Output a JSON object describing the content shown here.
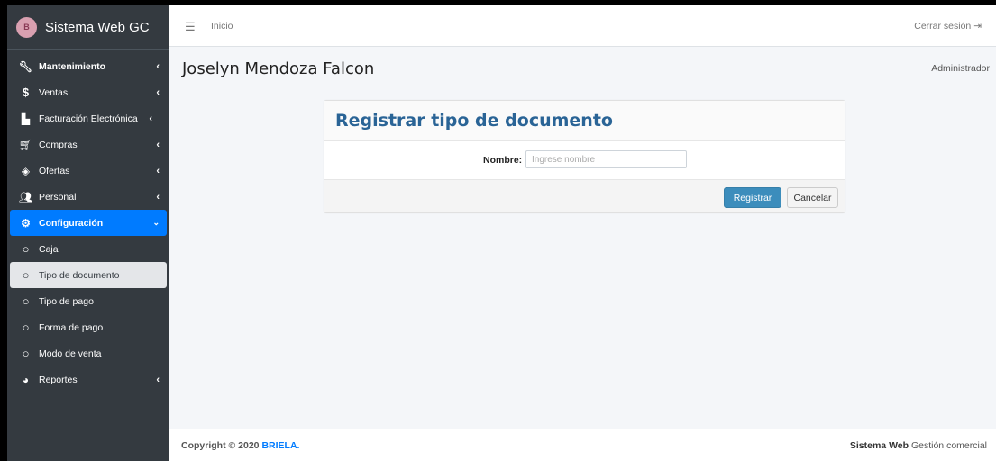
{
  "brand": {
    "name": "Sistema Web GC",
    "logo_text": "B"
  },
  "sidebar": {
    "items": [
      {
        "label": "Mantenimiento",
        "icon": "wrench-icon"
      },
      {
        "label": "Ventas",
        "icon": "dollar-icon"
      },
      {
        "label": "Facturación Electrónica",
        "icon": "building-icon"
      },
      {
        "label": "Compras",
        "icon": "cart-icon"
      },
      {
        "label": "Ofertas",
        "icon": "tags-icon"
      },
      {
        "label": "Personal",
        "icon": "users-icon"
      },
      {
        "label": "Configuración",
        "icon": "gear-icon"
      },
      {
        "label": "Caja",
        "icon": "circle-icon"
      },
      {
        "label": "Tipo de documento",
        "icon": "circle-icon"
      },
      {
        "label": "Tipo de pago",
        "icon": "circle-icon"
      },
      {
        "label": "Forma de pago",
        "icon": "circle-icon"
      },
      {
        "label": "Modo de venta",
        "icon": "circle-icon"
      },
      {
        "label": "Reportes",
        "icon": "pie-chart-icon"
      }
    ]
  },
  "topbar": {
    "home": "Inicio",
    "logout": "Cerrar sesión"
  },
  "header": {
    "user": "Joselyn Mendoza Falcon",
    "role": "Administrador"
  },
  "form": {
    "title": "Registrar tipo de documento",
    "name_label": "Nombre:",
    "name_value": "",
    "name_placeholder": "Ingrese nombre",
    "submit": "Registrar",
    "cancel": "Cancelar"
  },
  "footer": {
    "copyright": "Copyright © 2020 ",
    "company": "BRIELA.",
    "right_bold": "Sistema Web",
    "right_text": " Gestión comercial"
  },
  "colors": {
    "sidebar": "#343a40",
    "active": "#007bff",
    "primary_button": "#3c8dbc",
    "title": "#2a6496"
  }
}
